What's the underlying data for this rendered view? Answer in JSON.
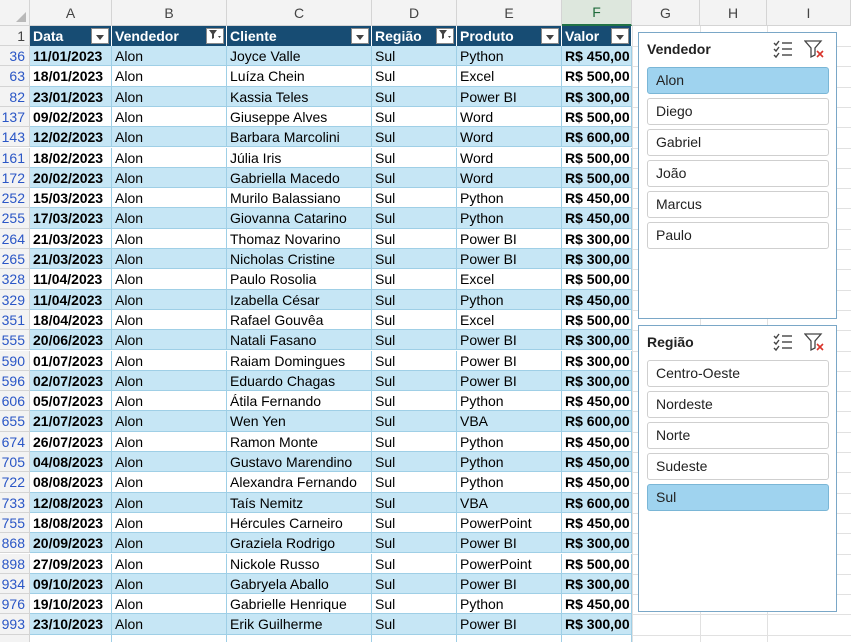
{
  "column_headers": [
    "A",
    "B",
    "C",
    "D",
    "E",
    "F",
    "G",
    "H",
    "I"
  ],
  "first_row_number": "1",
  "table": {
    "headers": [
      "Data",
      "Vendedor",
      "Cliente",
      "Região",
      "Produto",
      "Valor"
    ],
    "filtered_columns": [
      "Vendedor",
      "Região"
    ],
    "rows": [
      {
        "row": "36",
        "data": "11/01/2023",
        "vendedor": "Alon",
        "cliente": "Joyce Valle",
        "regiao": "Sul",
        "produto": "Python",
        "valor": "R$ 450,00"
      },
      {
        "row": "63",
        "data": "18/01/2023",
        "vendedor": "Alon",
        "cliente": "Luíza Chein",
        "regiao": "Sul",
        "produto": "Excel",
        "valor": "R$ 500,00"
      },
      {
        "row": "82",
        "data": "23/01/2023",
        "vendedor": "Alon",
        "cliente": "Kassia Teles",
        "regiao": "Sul",
        "produto": "Power BI",
        "valor": "R$ 300,00"
      },
      {
        "row": "137",
        "data": "09/02/2023",
        "vendedor": "Alon",
        "cliente": "Giuseppe Alves",
        "regiao": "Sul",
        "produto": "Word",
        "valor": "R$ 500,00"
      },
      {
        "row": "143",
        "data": "12/02/2023",
        "vendedor": "Alon",
        "cliente": "Barbara Marcolini",
        "regiao": "Sul",
        "produto": "Word",
        "valor": "R$ 600,00"
      },
      {
        "row": "161",
        "data": "18/02/2023",
        "vendedor": "Alon",
        "cliente": "Júlia Iris",
        "regiao": "Sul",
        "produto": "Word",
        "valor": "R$ 500,00"
      },
      {
        "row": "172",
        "data": "20/02/2023",
        "vendedor": "Alon",
        "cliente": "Gabriella Macedo",
        "regiao": "Sul",
        "produto": "Word",
        "valor": "R$ 500,00"
      },
      {
        "row": "252",
        "data": "15/03/2023",
        "vendedor": "Alon",
        "cliente": "Murilo Balassiano",
        "regiao": "Sul",
        "produto": "Python",
        "valor": "R$ 450,00"
      },
      {
        "row": "255",
        "data": "17/03/2023",
        "vendedor": "Alon",
        "cliente": "Giovanna Catarino",
        "regiao": "Sul",
        "produto": "Python",
        "valor": "R$ 450,00"
      },
      {
        "row": "264",
        "data": "21/03/2023",
        "vendedor": "Alon",
        "cliente": "Thomaz Novarino",
        "regiao": "Sul",
        "produto": "Power BI",
        "valor": "R$ 300,00"
      },
      {
        "row": "265",
        "data": "21/03/2023",
        "vendedor": "Alon",
        "cliente": "Nicholas Cristine",
        "regiao": "Sul",
        "produto": "Power BI",
        "valor": "R$ 300,00"
      },
      {
        "row": "328",
        "data": "11/04/2023",
        "vendedor": "Alon",
        "cliente": "Paulo Rosolia",
        "regiao": "Sul",
        "produto": "Excel",
        "valor": "R$ 500,00"
      },
      {
        "row": "329",
        "data": "11/04/2023",
        "vendedor": "Alon",
        "cliente": "Izabella César",
        "regiao": "Sul",
        "produto": "Python",
        "valor": "R$ 450,00"
      },
      {
        "row": "351",
        "data": "18/04/2023",
        "vendedor": "Alon",
        "cliente": "Rafael Gouvêa",
        "regiao": "Sul",
        "produto": "Excel",
        "valor": "R$ 500,00"
      },
      {
        "row": "555",
        "data": "20/06/2023",
        "vendedor": "Alon",
        "cliente": "Natali Fasano",
        "regiao": "Sul",
        "produto": "Power BI",
        "valor": "R$ 300,00"
      },
      {
        "row": "590",
        "data": "01/07/2023",
        "vendedor": "Alon",
        "cliente": "Raiam Domingues",
        "regiao": "Sul",
        "produto": "Power BI",
        "valor": "R$ 300,00"
      },
      {
        "row": "596",
        "data": "02/07/2023",
        "vendedor": "Alon",
        "cliente": "Eduardo Chagas",
        "regiao": "Sul",
        "produto": "Power BI",
        "valor": "R$ 300,00"
      },
      {
        "row": "606",
        "data": "05/07/2023",
        "vendedor": "Alon",
        "cliente": "Átila Fernando",
        "regiao": "Sul",
        "produto": "Python",
        "valor": "R$ 450,00"
      },
      {
        "row": "655",
        "data": "21/07/2023",
        "vendedor": "Alon",
        "cliente": "Wen Yen",
        "regiao": "Sul",
        "produto": "VBA",
        "valor": "R$ 600,00"
      },
      {
        "row": "674",
        "data": "26/07/2023",
        "vendedor": "Alon",
        "cliente": "Ramon Monte",
        "regiao": "Sul",
        "produto": "Python",
        "valor": "R$ 450,00"
      },
      {
        "row": "705",
        "data": "04/08/2023",
        "vendedor": "Alon",
        "cliente": "Gustavo Marendino",
        "regiao": "Sul",
        "produto": "Python",
        "valor": "R$ 450,00"
      },
      {
        "row": "722",
        "data": "08/08/2023",
        "vendedor": "Alon",
        "cliente": "Alexandra Fernando",
        "regiao": "Sul",
        "produto": "Python",
        "valor": "R$ 450,00"
      },
      {
        "row": "733",
        "data": "12/08/2023",
        "vendedor": "Alon",
        "cliente": "Taís Nemitz",
        "regiao": "Sul",
        "produto": "VBA",
        "valor": "R$ 600,00"
      },
      {
        "row": "755",
        "data": "18/08/2023",
        "vendedor": "Alon",
        "cliente": "Hércules Carneiro",
        "regiao": "Sul",
        "produto": "PowerPoint",
        "valor": "R$ 450,00"
      },
      {
        "row": "868",
        "data": "20/09/2023",
        "vendedor": "Alon",
        "cliente": "Graziela Rodrigo",
        "regiao": "Sul",
        "produto": "Power BI",
        "valor": "R$ 300,00"
      },
      {
        "row": "898",
        "data": "27/09/2023",
        "vendedor": "Alon",
        "cliente": "Nickole Russo",
        "regiao": "Sul",
        "produto": "PowerPoint",
        "valor": "R$ 500,00"
      },
      {
        "row": "934",
        "data": "09/10/2023",
        "vendedor": "Alon",
        "cliente": "Gabryela Aballo",
        "regiao": "Sul",
        "produto": "Power BI",
        "valor": "R$ 300,00"
      },
      {
        "row": "976",
        "data": "19/10/2023",
        "vendedor": "Alon",
        "cliente": "Gabrielle Henrique",
        "regiao": "Sul",
        "produto": "Python",
        "valor": "R$ 450,00"
      },
      {
        "row": "993",
        "data": "23/10/2023",
        "vendedor": "Alon",
        "cliente": "Erik Guilherme",
        "regiao": "Sul",
        "produto": "Power BI",
        "valor": "R$ 300,00"
      }
    ]
  },
  "slicers": {
    "vendedor": {
      "title": "Vendedor",
      "items": [
        "Alon",
        "Diego",
        "Gabriel",
        "João",
        "Marcus",
        "Paulo"
      ],
      "selected": [
        "Alon"
      ],
      "multiselect_icon": "multiselect-icon",
      "clear_filter_icon": "clear-filter-icon"
    },
    "regiao": {
      "title": "Região",
      "items": [
        "Centro-Oeste",
        "Nordeste",
        "Norte",
        "Sudeste",
        "Sul"
      ],
      "selected": [
        "Sul"
      ],
      "multiselect_icon": "multiselect-icon",
      "clear_filter_icon": "clear-filter-icon"
    }
  },
  "colors": {
    "header_fill": "#174c73",
    "band_fill": "#c6e6f5",
    "slicer_selected": "#9fd3ef"
  }
}
